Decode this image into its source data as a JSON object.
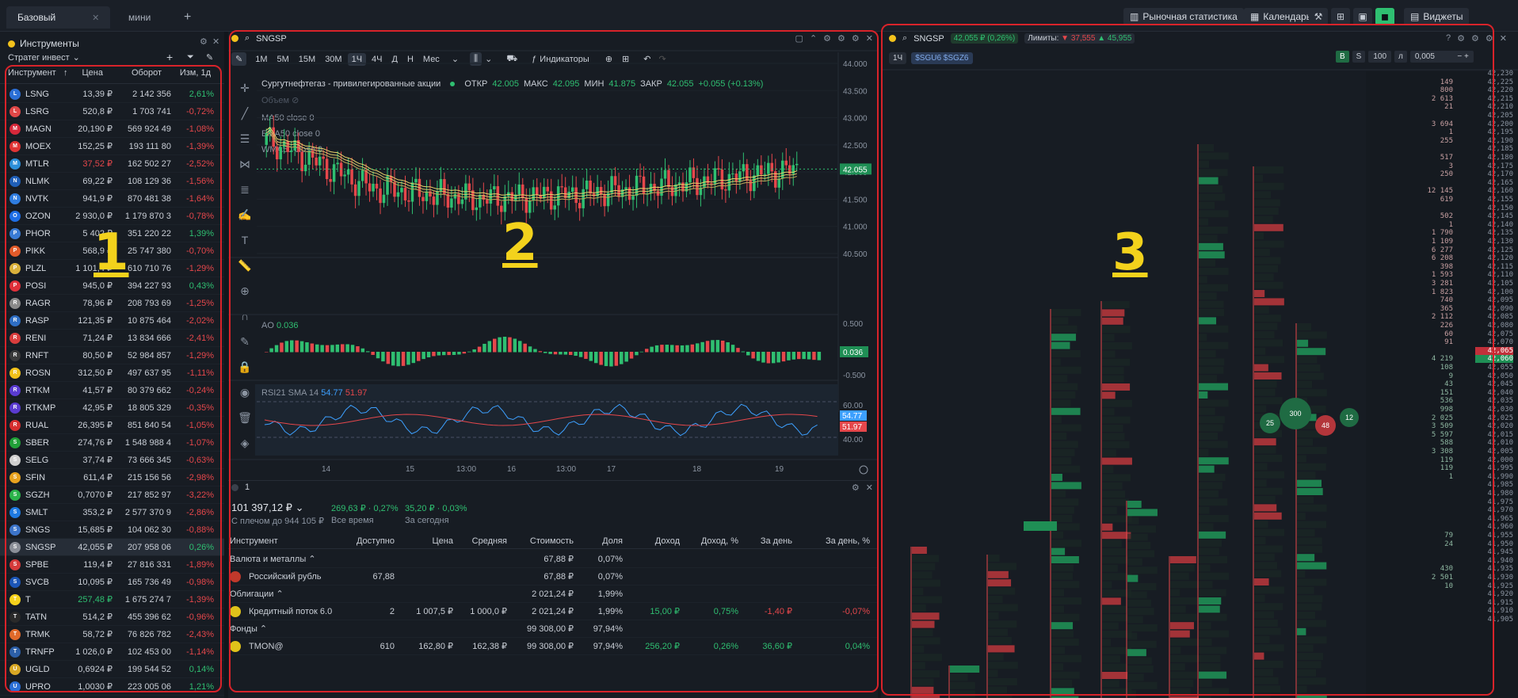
{
  "tabs": [
    {
      "label": "Базовый"
    },
    {
      "label": "мини"
    }
  ],
  "topbar": {
    "market_stats": "Рыночная статистика",
    "calendar": "Календарь",
    "widgets": "Виджеты"
  },
  "instruments": {
    "title": "Инструменты",
    "strategy": "Стратег инвест",
    "headers": {
      "ticker": "Инструмент",
      "price": "Цена",
      "turnover": "Оборот",
      "change": "Изм, 1д"
    },
    "rows": [
      {
        "ticker": "LSNG",
        "price": "13,39 ₽",
        "turnover": "2 142 356",
        "change": "2,61%",
        "dir": "up",
        "color": "#2b6fd6"
      },
      {
        "ticker": "LSRG",
        "price": "520,8 ₽",
        "turnover": "1 703 741",
        "change": "-0,72%",
        "dir": "dn",
        "color": "#e04848"
      },
      {
        "ticker": "MAGN",
        "price": "20,190 ₽",
        "turnover": "569 924 49",
        "change": "-1,08%",
        "dir": "dn",
        "color": "#d6283a"
      },
      {
        "ticker": "MOEX",
        "price": "152,25 ₽",
        "turnover": "193 111 80",
        "change": "-1,39%",
        "dir": "dn",
        "color": "#e03434"
      },
      {
        "ticker": "MTLR",
        "price": "37,52 ₽",
        "turnover": "162 502 27",
        "change": "-2,52%",
        "dir": "dn",
        "color": "#2c8fd9",
        "pricedir": "dn"
      },
      {
        "ticker": "NLMK",
        "price": "69,22 ₽",
        "turnover": "108 129 36",
        "change": "-1,56%",
        "dir": "dn",
        "color": "#1f5fb8"
      },
      {
        "ticker": "NVTK",
        "price": "941,9 ₽",
        "turnover": "870 481 38",
        "change": "-1,64%",
        "dir": "dn",
        "color": "#2f7de0"
      },
      {
        "ticker": "OZON",
        "price": "2 930,0 ₽",
        "turnover": "1 179 870 3",
        "change": "-0,78%",
        "dir": "dn",
        "color": "#1e6ee6"
      },
      {
        "ticker": "PHOR",
        "price": "5 402 ₽",
        "turnover": "351 220 22",
        "change": "1,39%",
        "dir": "up",
        "color": "#3a7bd5"
      },
      {
        "ticker": "PIKK",
        "price": "568,9 ₽",
        "turnover": "25 747 380",
        "change": "-0,70%",
        "dir": "dn",
        "color": "#e25b2a"
      },
      {
        "ticker": "PLZL",
        "price": "1 101,4 ₽",
        "turnover": "610 710 76",
        "change": "-1,29%",
        "dir": "dn",
        "color": "#d9b13b"
      },
      {
        "ticker": "POSI",
        "price": "945,0 ₽",
        "turnover": "394 227 93",
        "change": "0,43%",
        "dir": "up",
        "color": "#e0303a"
      },
      {
        "ticker": "RAGR",
        "price": "78,96 ₽",
        "turnover": "208 793 69",
        "change": "-1,25%",
        "dir": "dn",
        "color": "#8a8a8a"
      },
      {
        "ticker": "RASP",
        "price": "121,35 ₽",
        "turnover": "10 875 464",
        "change": "-2,02%",
        "dir": "dn",
        "color": "#2e6ec4"
      },
      {
        "ticker": "RENI",
        "price": "71,24 ₽",
        "turnover": "13 834 666",
        "change": "-2,41%",
        "dir": "dn",
        "color": "#d83d3d"
      },
      {
        "ticker": "RNFT",
        "price": "80,50 ₽",
        "turnover": "52 984 857",
        "change": "-1,29%",
        "dir": "dn",
        "color": "#3a3a3a"
      },
      {
        "ticker": "ROSN",
        "price": "312,50 ₽",
        "turnover": "497 637 95",
        "change": "-1,11%",
        "dir": "dn",
        "color": "#f2c21a"
      },
      {
        "ticker": "RTKM",
        "price": "41,57 ₽",
        "turnover": "80 379 662",
        "change": "-0,24%",
        "dir": "dn",
        "color": "#5a3bd1"
      },
      {
        "ticker": "RTKMP",
        "price": "42,95 ₽",
        "turnover": "18 805 329",
        "change": "-0,35%",
        "dir": "dn",
        "color": "#5a3bd1"
      },
      {
        "ticker": "RUAL",
        "price": "26,395 ₽",
        "turnover": "851 840 54",
        "change": "-1,05%",
        "dir": "dn",
        "color": "#d62e2e"
      },
      {
        "ticker": "SBER",
        "price": "274,76 ₽",
        "turnover": "1 548 988 4",
        "change": "-1,07%",
        "dir": "dn",
        "color": "#21a038"
      },
      {
        "ticker": "SELG",
        "price": "37,74 ₽",
        "turnover": "73 666 345",
        "change": "-0,63%",
        "dir": "dn",
        "color": "#d0d0d0"
      },
      {
        "ticker": "SFIN",
        "price": "611,4 ₽",
        "turnover": "215 156 56",
        "change": "-2,98%",
        "dir": "dn",
        "color": "#e8a21e"
      },
      {
        "ticker": "SGZH",
        "price": "0,7070 ₽",
        "turnover": "217 852 97",
        "change": "-3,22%",
        "dir": "dn",
        "color": "#2bb34a"
      },
      {
        "ticker": "SMLT",
        "price": "353,2 ₽",
        "turnover": "2 577 370 9",
        "change": "-2,86%",
        "dir": "dn",
        "color": "#1f7ae0"
      },
      {
        "ticker": "SNGS",
        "price": "15,685 ₽",
        "turnover": "104 062 30",
        "change": "-0,88%",
        "dir": "dn",
        "color": "#3c74c9"
      },
      {
        "ticker": "SNGSP",
        "price": "42,055 ₽",
        "turnover": "207 958 06",
        "change": "0,26%",
        "dir": "up",
        "color": "#8b8f98",
        "selected": true
      },
      {
        "ticker": "SPBE",
        "price": "119,4 ₽",
        "turnover": "27 816 331",
        "change": "-1,89%",
        "dir": "dn",
        "color": "#d63a3a"
      },
      {
        "ticker": "SVCB",
        "price": "10,095 ₽",
        "turnover": "165 736 49",
        "change": "-0,98%",
        "dir": "dn",
        "color": "#1c56b8"
      },
      {
        "ticker": "T",
        "price": "257,48 ₽",
        "turnover": "1 675 274 7",
        "change": "-1,39%",
        "dir": "dn",
        "color": "#f5d21c",
        "pricedir": "up"
      },
      {
        "ticker": "TATN",
        "price": "514,2 ₽",
        "turnover": "455 396 62",
        "change": "-0,96%",
        "dir": "dn",
        "color": "#2a2a2a"
      },
      {
        "ticker": "TRMK",
        "price": "58,72 ₽",
        "turnover": "76 826 782",
        "change": "-2,43%",
        "dir": "dn",
        "color": "#e06a2a"
      },
      {
        "ticker": "TRNFP",
        "price": "1 026,0 ₽",
        "turnover": "102 453 00",
        "change": "-1,14%",
        "dir": "dn",
        "color": "#2c5fa8"
      },
      {
        "ticker": "UGLD",
        "price": "0,6924 ₽",
        "turnover": "199 544 52",
        "change": "0,14%",
        "dir": "up",
        "color": "#d8a825"
      },
      {
        "ticker": "UPRO",
        "price": "1,0030 ₽",
        "turnover": "223 005 06",
        "change": "1,21%",
        "dir": "up",
        "color": "#2b6fd6"
      }
    ]
  },
  "chart": {
    "symbol": "SNGSP",
    "timeframes": [
      "1М",
      "5М",
      "15М",
      "30М",
      "1Ч",
      "4Ч",
      "Д",
      "Н",
      "Мес"
    ],
    "active_tf": "1Ч",
    "indicators_label": "Индикаторы",
    "title": "Сургутнефтегаз - привилегированные акции",
    "ohlc": {
      "o_label": "ОТКР",
      "o": "42.005",
      "h_label": "МАКС",
      "h": "42.095",
      "l_label": "МИН",
      "l": "41.875",
      "c_label": "ЗАКР",
      "c": "42.055",
      "chg": "+0.055 (+0.13%)"
    },
    "volume_label": "Объем",
    "ma_labels": [
      "MA50 close 0",
      "EMA50 close 0",
      "WMA50 close 0"
    ],
    "price_axis": [
      "44.000",
      "43.500",
      "43.000",
      "42.500",
      "42.000",
      "41.500",
      "41.000",
      "40.500"
    ],
    "last_price": "42.055",
    "ao_label": "AO",
    "ao_val": "0.036",
    "ao_axis": [
      "0.500",
      "-0.500"
    ],
    "rsi_label": "RSI21 SMA 14",
    "rsi_v1": "54.77",
    "rsi_v2": "51.97",
    "rsi_axis": [
      "60.00",
      "40.00"
    ],
    "x_labels": [
      "14",
      "15",
      "13:00",
      "16",
      "13:00",
      "17",
      "18",
      "19"
    ]
  },
  "chart_data": {
    "type": "line",
    "title": "Сургутнефтегаз - привилегированные акции",
    "x": [
      "14",
      "15",
      "16",
      "17",
      "18",
      "19"
    ],
    "series": [
      {
        "name": "SNGSP",
        "values": [
          42.6,
          41.7,
          41.5,
          41.6,
          41.8,
          42.05
        ]
      }
    ],
    "ylim": [
      40.5,
      44.0
    ]
  },
  "portfolio": {
    "tab": "1",
    "total": "101 397,12 ₽",
    "leverage": "С плечом до 944 105 ₽",
    "all_time_val": "269,63 ₽ · 0,27%",
    "all_time_label": "Все время",
    "today_val": "35,20 ₽ · 0,03%",
    "today_label": "За сегодня",
    "headers": [
      "Инструмент",
      "Доступно",
      "Цена",
      "Средняя",
      "Стоимость",
      "Доля",
      "Доход",
      "Доход, %",
      "За день",
      "За день, %"
    ],
    "groups": [
      {
        "name": "Валюта и металлы",
        "cost": "67,88 ₽",
        "share": "0,07%"
      },
      {
        "name": "Облигации",
        "cost": "2 021,24 ₽",
        "share": "1,99%"
      },
      {
        "name": "Фонды",
        "cost": "99 308,00 ₽",
        "share": "97,94%"
      }
    ],
    "items": [
      {
        "name": "Российский рубль",
        "avail": "67,88",
        "price": "",
        "avg": "",
        "cost": "67,88 ₽",
        "share": "0,07%",
        "inc": "",
        "incp": "",
        "day": "",
        "dayp": ""
      },
      {
        "name": "Кредитный поток 6.0",
        "avail": "2",
        "price": "1 007,5 ₽",
        "avg": "1 000,0 ₽",
        "cost": "2 021,24 ₽",
        "share": "1,99%",
        "inc": "15,00 ₽",
        "incp": "0,75%",
        "day": "-1,40 ₽",
        "dayp": "-0,07%"
      },
      {
        "name": "TMON@",
        "avail": "610",
        "price": "162,80 ₽",
        "avg": "162,38 ₽",
        "cost": "99 308,00 ₽",
        "share": "97,94%",
        "inc": "256,20 ₽",
        "incp": "0,26%",
        "day": "36,60 ₽",
        "dayp": "0,04%"
      }
    ]
  },
  "orderbook": {
    "symbol": "SNGSP",
    "price_badge": "42,055 ₽ (0,26%)",
    "limits_label": "Лимиты:",
    "limit_low": "▼ 37,555",
    "limit_high": "▲ 45,955",
    "tf": "1Ч",
    "tickers": "$SGU6 $SGZ6",
    "b": "B",
    "s": "S",
    "qty": "100",
    "l": "л",
    "step": "0,005",
    "circles": [
      "25",
      "300",
      "48",
      "12"
    ],
    "levels": [
      {
        "p": "42,230",
        "v": ""
      },
      {
        "p": "42,225",
        "v": "149"
      },
      {
        "p": "42,220",
        "v": "800"
      },
      {
        "p": "42,215",
        "v": "2 613"
      },
      {
        "p": "42,210",
        "v": "21"
      },
      {
        "p": "42,205",
        "v": ""
      },
      {
        "p": "42,200",
        "v": "3 694"
      },
      {
        "p": "42,195",
        "v": "1"
      },
      {
        "p": "42,190",
        "v": "255"
      },
      {
        "p": "42,185",
        "v": ""
      },
      {
        "p": "42,180",
        "v": "517"
      },
      {
        "p": "42,175",
        "v": "3"
      },
      {
        "p": "42,170",
        "v": "250"
      },
      {
        "p": "42,165",
        "v": ""
      },
      {
        "p": "42,160",
        "v": "12 145"
      },
      {
        "p": "42,155",
        "v": "619"
      },
      {
        "p": "42,150",
        "v": ""
      },
      {
        "p": "42,145",
        "v": "502"
      },
      {
        "p": "42,140",
        "v": "1"
      },
      {
        "p": "42,135",
        "v": "1 790"
      },
      {
        "p": "42,130",
        "v": "1 109"
      },
      {
        "p": "42,125",
        "v": "6 277"
      },
      {
        "p": "42,120",
        "v": "6 208"
      },
      {
        "p": "42,115",
        "v": "398"
      },
      {
        "p": "42,110",
        "v": "1 593"
      },
      {
        "p": "42,105",
        "v": "3 281"
      },
      {
        "p": "42,100",
        "v": "1 823"
      },
      {
        "p": "42,095",
        "v": "740"
      },
      {
        "p": "42,090",
        "v": "365"
      },
      {
        "p": "42,085",
        "v": "2 112"
      },
      {
        "p": "42,080",
        "v": "226"
      },
      {
        "p": "42,075",
        "v": "60"
      },
      {
        "p": "42,070",
        "v": "91"
      },
      {
        "p": "42,065",
        "v": ""
      },
      {
        "p": "42,060",
        "v": "4 219"
      },
      {
        "p": "42,055",
        "v": "108"
      },
      {
        "p": "42,050",
        "v": "9"
      },
      {
        "p": "42,045",
        "v": "43"
      },
      {
        "p": "42,040",
        "v": "151"
      },
      {
        "p": "42,035",
        "v": "536"
      },
      {
        "p": "42,030",
        "v": "998"
      },
      {
        "p": "42,025",
        "v": "2 025"
      },
      {
        "p": "42,020",
        "v": "3 509"
      },
      {
        "p": "42,015",
        "v": "5 597"
      },
      {
        "p": "42,010",
        "v": "588"
      },
      {
        "p": "42,005",
        "v": "3 308"
      },
      {
        "p": "42,000",
        "v": "119"
      },
      {
        "p": "41,995",
        "v": "119"
      },
      {
        "p": "41,990",
        "v": "1"
      },
      {
        "p": "41,985",
        "v": ""
      },
      {
        "p": "41,980",
        "v": ""
      },
      {
        "p": "41,975",
        "v": ""
      },
      {
        "p": "41,970",
        "v": ""
      },
      {
        "p": "41,965",
        "v": ""
      },
      {
        "p": "41,960",
        "v": ""
      },
      {
        "p": "41,955",
        "v": "79"
      },
      {
        "p": "41,950",
        "v": "24"
      },
      {
        "p": "41,945",
        "v": ""
      },
      {
        "p": "41,940",
        "v": ""
      },
      {
        "p": "41,935",
        "v": "430"
      },
      {
        "p": "41,930",
        "v": "2 501"
      },
      {
        "p": "41,925",
        "v": "10"
      },
      {
        "p": "41,920",
        "v": ""
      },
      {
        "p": "41,915",
        "v": ""
      },
      {
        "p": "41,910",
        "v": ""
      },
      {
        "p": "41,905",
        "v": ""
      }
    ]
  },
  "colors": {
    "accent": "#2fbf71",
    "down": "#e5474b",
    "frame": "#d8232a",
    "label": "#f3d21c"
  }
}
